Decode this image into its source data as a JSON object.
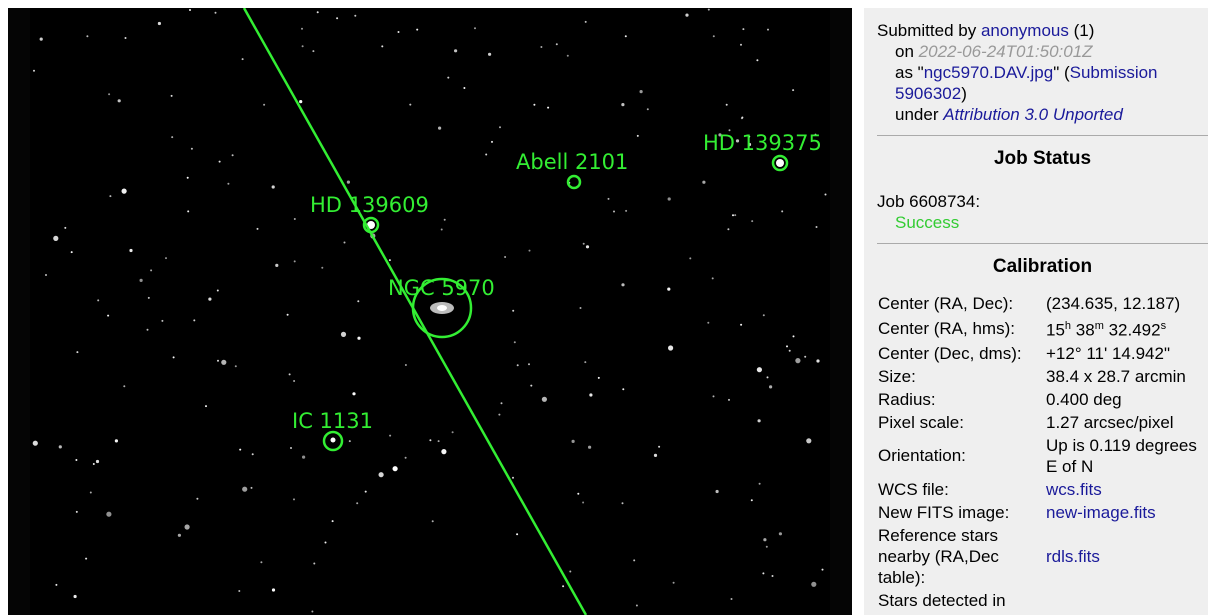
{
  "sky_labels": {
    "hd139375": "HD 139375",
    "abell2101": "Abell 2101",
    "hd139609": "HD 139609",
    "ngc5970": "NGC 5970",
    "ic1131": "IC 1131"
  },
  "colors": {
    "annotation": "#33ee33",
    "link": "#1a1a9a",
    "success": "#33cc33",
    "panel_bg": "#efefef"
  },
  "submission": {
    "prefix": "Submitted by",
    "user": "anonymous",
    "user_count": "(1)",
    "on_label": "on",
    "date": "2022-06-24T01:50:01Z",
    "as_label": "as \"",
    "filename": "ngc5970.DAV.jpg",
    "as_close": "\" (",
    "submission_link": "Submission 5906302",
    "submission_close": ")",
    "under_label": "under",
    "license": "Attribution 3.0 Unported"
  },
  "job_status": {
    "title": "Job Status",
    "job_label": "Job 6608734:",
    "status": "Success"
  },
  "calibration": {
    "title": "Calibration",
    "center_radec_label": "Center (RA, Dec):",
    "center_radec": "(234.635, 12.187)",
    "center_hms_label": "Center (RA, hms):",
    "ra_h": "15",
    "ra_h_unit": "h",
    "ra_m": " 38",
    "ra_m_unit": "m",
    "ra_s": " 32.492",
    "ra_s_unit": "s",
    "center_dms_label": "Center (Dec, dms):",
    "center_dms": "+12° 11' 14.942\"",
    "size_label": "Size:",
    "size": "38.4 x 28.7 arcmin",
    "radius_label": "Radius:",
    "radius": "0.400 deg",
    "pixel_scale_label": "Pixel scale:",
    "pixel_scale": "1.27 arcsec/pixel",
    "orientation_label": "Orientation:",
    "orientation": "Up is 0.119 degrees E of N",
    "wcs_label": "WCS file:",
    "wcs": "wcs.fits",
    "fits_label": "New FITS image:",
    "fits": "new-image.fits",
    "ref_label": "Reference stars nearby (RA,Dec table):",
    "ref": "rdls.fits",
    "stars_label": "Stars detected in"
  }
}
